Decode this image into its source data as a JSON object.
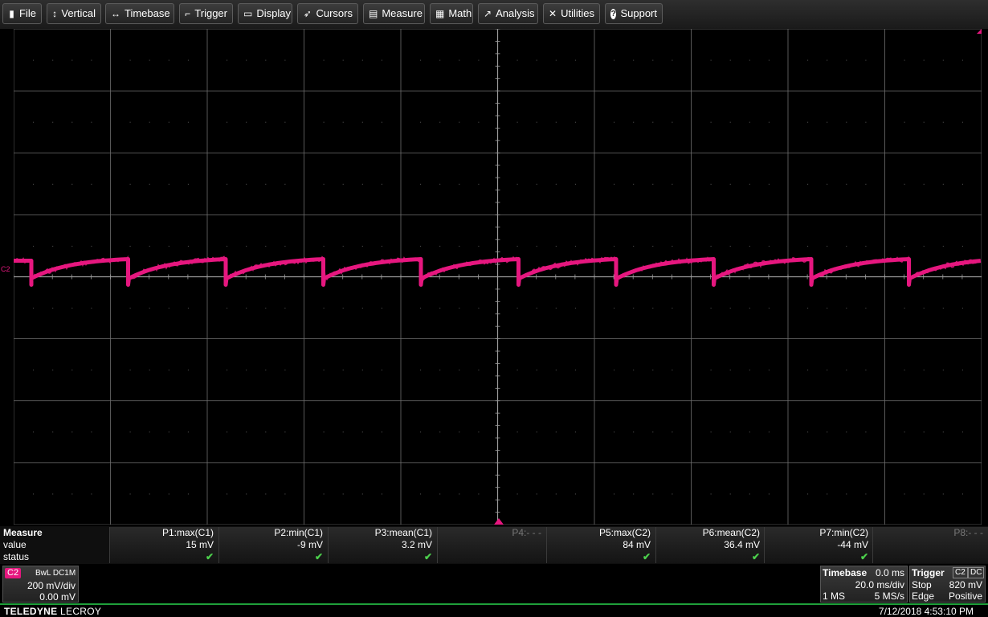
{
  "menu": [
    {
      "label": "File",
      "icon": "file-icon"
    },
    {
      "label": "Vertical",
      "icon": "vertical-arrows-icon"
    },
    {
      "label": "Timebase",
      "icon": "horizontal-arrows-icon"
    },
    {
      "label": "Trigger",
      "icon": "trigger-icon"
    },
    {
      "label": "Display",
      "icon": "display-icon"
    },
    {
      "label": "Cursors",
      "icon": "cursor-icon"
    },
    {
      "label": "Measure",
      "icon": "measure-icon"
    },
    {
      "label": "Math",
      "icon": "calculator-icon"
    },
    {
      "label": "Analysis",
      "icon": "analysis-icon"
    },
    {
      "label": "Utilities",
      "icon": "wrench-icon"
    },
    {
      "label": "Support",
      "icon": "help-icon"
    }
  ],
  "trace": {
    "label": "C2",
    "color": "#e6177f"
  },
  "measure": {
    "title": "Measure",
    "row_labels": [
      "value",
      "status"
    ],
    "params": [
      {
        "name": "P1:max(C1)",
        "value": "15 mV",
        "status": "✔"
      },
      {
        "name": "P2:min(C1)",
        "value": "-9 mV",
        "status": "✔"
      },
      {
        "name": "P3:mean(C1)",
        "value": "3.2 mV",
        "status": "✔"
      },
      {
        "name": "P4:- - -",
        "value": "",
        "status": ""
      },
      {
        "name": "P5:max(C2)",
        "value": "84 mV",
        "status": "✔"
      },
      {
        "name": "P6:mean(C2)",
        "value": "36.4 mV",
        "status": "✔"
      },
      {
        "name": "P7:min(C2)",
        "value": "-44 mV",
        "status": "✔"
      },
      {
        "name": "P8:- - -",
        "value": "",
        "status": ""
      }
    ]
  },
  "channel": {
    "tag": "C2",
    "coupling": "BwL DC1M",
    "scale": "200 mV/div",
    "offset": "0.00 mV"
  },
  "timebase": {
    "title": "Timebase",
    "delay": "0.0 ms",
    "scale": "20.0 ms/div",
    "points": "1 MS",
    "rate": "5 MS/s"
  },
  "trigger": {
    "title": "Trigger",
    "source": "C2",
    "coupling": "DC",
    "mode": "Stop",
    "level": "820 mV",
    "type": "Edge",
    "slope": "Positive"
  },
  "footer": {
    "brand_bold": "TELEDYNE",
    "brand_rest": " LECROY",
    "timestamp": "7/12/2018 4:53:10 PM"
  },
  "colors": {
    "trace": "#e6177f",
    "grid": "#6e6e6e",
    "status_ok": "#4cd04c",
    "accent_bar": "#1fa03a"
  }
}
